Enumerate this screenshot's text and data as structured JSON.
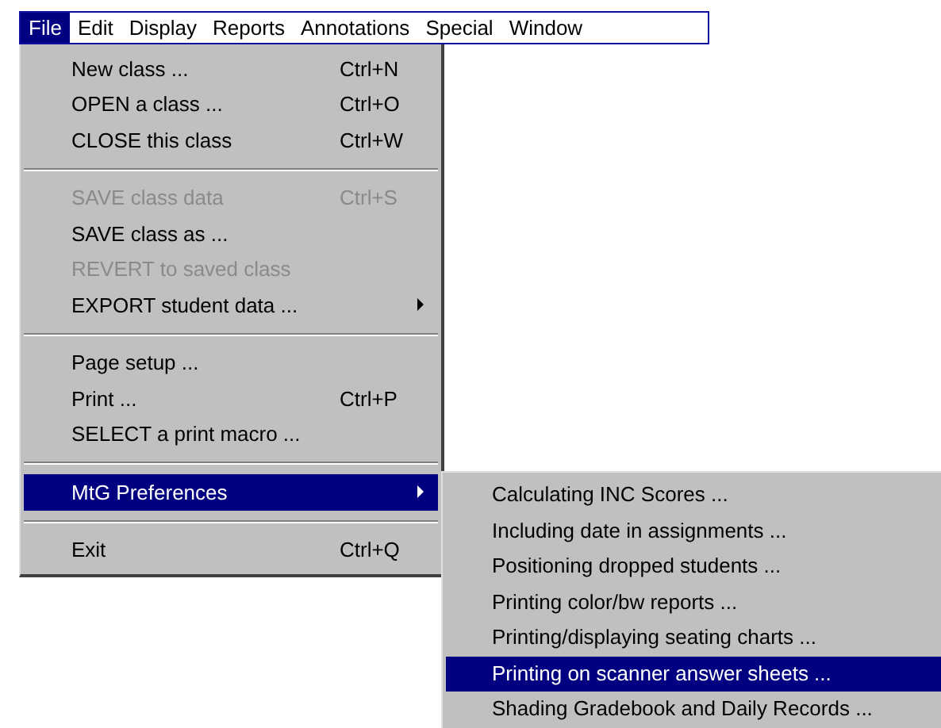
{
  "menubar": [
    {
      "label": "File",
      "selected": true
    },
    {
      "label": "Edit",
      "selected": false
    },
    {
      "label": "Display",
      "selected": false
    },
    {
      "label": "Reports",
      "selected": false
    },
    {
      "label": "Annotations",
      "selected": false
    },
    {
      "label": "Special",
      "selected": false
    },
    {
      "label": "Window",
      "selected": false
    }
  ],
  "file_menu": [
    {
      "kind": "item",
      "label": "New class ...",
      "shortcut": "Ctrl+N",
      "disabled": false,
      "submenu": false,
      "selected": false
    },
    {
      "kind": "item",
      "label": "OPEN a class ...",
      "shortcut": "Ctrl+O",
      "disabled": false,
      "submenu": false,
      "selected": false
    },
    {
      "kind": "item",
      "label": "CLOSE this class",
      "shortcut": "Ctrl+W",
      "disabled": false,
      "submenu": false,
      "selected": false
    },
    {
      "kind": "separator"
    },
    {
      "kind": "item",
      "label": "SAVE class data",
      "shortcut": "Ctrl+S",
      "disabled": true,
      "submenu": false,
      "selected": false
    },
    {
      "kind": "item",
      "label": "SAVE class as ...",
      "disabled": false,
      "submenu": false,
      "selected": false
    },
    {
      "kind": "item",
      "label": "REVERT to saved class",
      "disabled": true,
      "submenu": false,
      "selected": false
    },
    {
      "kind": "item",
      "label": "EXPORT student data ...",
      "disabled": false,
      "submenu": true,
      "selected": false
    },
    {
      "kind": "separator"
    },
    {
      "kind": "item",
      "label": "Page setup ...",
      "disabled": false,
      "submenu": false,
      "selected": false
    },
    {
      "kind": "item",
      "label": "Print ...",
      "shortcut": "Ctrl+P",
      "disabled": false,
      "submenu": false,
      "selected": false
    },
    {
      "kind": "item",
      "label": "SELECT a print macro ...",
      "disabled": false,
      "submenu": false,
      "selected": false
    },
    {
      "kind": "separator"
    },
    {
      "kind": "item",
      "label": "MtG Preferences",
      "disabled": false,
      "submenu": true,
      "selected": true
    },
    {
      "kind": "separator"
    },
    {
      "kind": "item",
      "label": "Exit",
      "shortcut": "Ctrl+Q",
      "disabled": false,
      "submenu": false,
      "selected": false
    }
  ],
  "preferences_submenu": [
    {
      "label": "Calculating INC Scores ...",
      "selected": false
    },
    {
      "label": "Including date in assignments ...",
      "selected": false
    },
    {
      "label": "Positioning dropped students ...",
      "selected": false
    },
    {
      "label": "Printing color/bw reports ...",
      "selected": false
    },
    {
      "label": "Printing/displaying seating charts ...",
      "selected": false
    },
    {
      "label": "Printing on scanner answer sheets ...",
      "selected": true
    },
    {
      "label": "Shading Gradebook and Daily Records ...",
      "selected": false
    }
  ]
}
